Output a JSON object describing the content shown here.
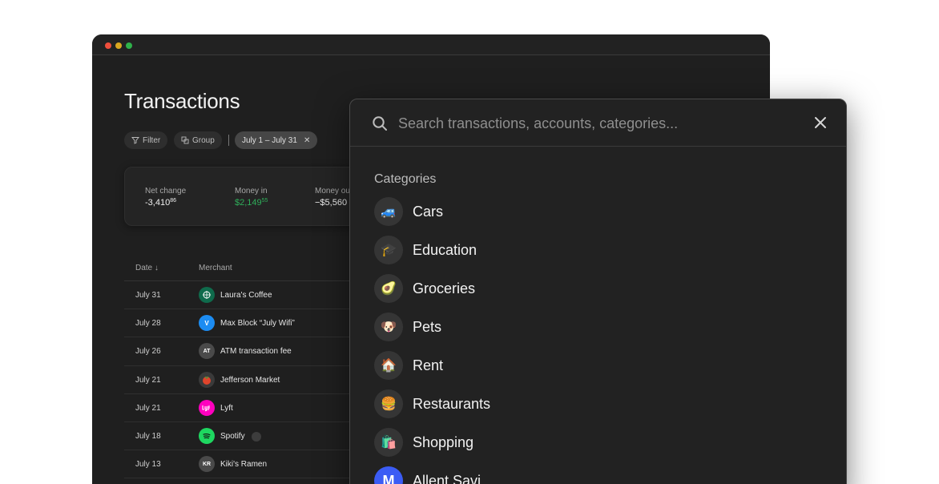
{
  "page": {
    "title": "Transactions",
    "chips": {
      "filter": "Filter",
      "group": "Group",
      "date_range": "July 1 – July 31"
    }
  },
  "summary": {
    "net_change": {
      "label": "Net change",
      "value": "-3,410",
      "cents": "86"
    },
    "money_in": {
      "label": "Money in",
      "value": "$2,149",
      "cents": "55"
    },
    "money_out": {
      "label": "Money ou",
      "value": "−$5,560"
    }
  },
  "table": {
    "headers": {
      "date": "Date",
      "merchant": "Merchant"
    },
    "rows": [
      {
        "date": "July 31",
        "merchant": "Laura's Coffee",
        "logo_text": "",
        "logo_color": "#0f6b4c"
      },
      {
        "date": "July 28",
        "merchant": "Max Block “July Wifi”",
        "logo_text": "V",
        "logo_color": "#1c8cf2"
      },
      {
        "date": "July 26",
        "merchant": "ATM transaction fee",
        "logo_text": "AT",
        "logo_color": "#4a4a4a"
      },
      {
        "date": "July 21",
        "merchant": "Jefferson Market",
        "logo_text": "",
        "logo_color": "#c8412a"
      },
      {
        "date": "July 21",
        "merchant": "Lyft",
        "logo_text": "",
        "logo_color": "#ff00bf"
      },
      {
        "date": "July 18",
        "merchant": "Spotify",
        "logo_text": "",
        "logo_color": "#1ed760"
      },
      {
        "date": "July 13",
        "merchant": "Kiki's Ramen",
        "logo_text": "KR",
        "logo_color": "#4a4a4a"
      }
    ]
  },
  "search": {
    "placeholder": "Search transactions, accounts, categories...",
    "section_title": "Categories",
    "categories": [
      {
        "name": "Cars",
        "emoji": "🚙"
      },
      {
        "name": "Education",
        "emoji": "🎓"
      },
      {
        "name": "Groceries",
        "emoji": "🥑"
      },
      {
        "name": "Pets",
        "emoji": "🐶"
      },
      {
        "name": "Rent",
        "emoji": "🏠"
      },
      {
        "name": "Restaurants",
        "emoji": "🍔"
      },
      {
        "name": "Shopping",
        "emoji": "🛍️"
      }
    ],
    "next_item": {
      "name": "Allent Savi",
      "emoji": "M"
    }
  }
}
